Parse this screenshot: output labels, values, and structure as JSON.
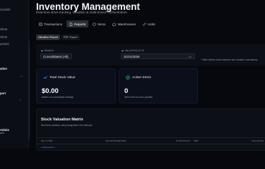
{
  "header": {
    "title": "Inventory Management",
    "subtitle": "Real-time stock tracking, valuation & multi-branch orchestration."
  },
  "sidebar": {
    "items": [
      "ccounts",
      "chers",
      "chers",
      "uchers",
      "ation",
      "port",
      "Admin",
      "ator"
    ]
  },
  "tabs": [
    {
      "label": "Transactions",
      "icon": "list-icon",
      "active": false
    },
    {
      "label": "Reports",
      "icon": "document-icon",
      "active": true
    },
    {
      "label": "Items",
      "icon": "box-icon",
      "active": false
    },
    {
      "label": "Warehouses",
      "icon": "warehouse-icon",
      "active": false
    },
    {
      "label": "Units",
      "icon": "ruler-icon",
      "active": false
    }
  ],
  "report_tabs": [
    {
      "label": "Valuation Report",
      "active": true
    },
    {
      "label": "PDF Export",
      "active": false
    }
  ],
  "filters": {
    "branch_label": "BRANCH",
    "branch_value": "Consolidated (All)",
    "date_label": "VALUATION AS OF",
    "date_value": "31/01/2026",
    "note": "* Table reflects stock balances and valuation calculations."
  },
  "cards": [
    {
      "title": "Total Stock Value",
      "value": "$0.00",
      "sub": "Based on consolidated holdings",
      "icon": "trend-icon",
      "icon_color": "#3b82f6"
    },
    {
      "title": "Active SKUs",
      "value": "0",
      "sub": "Items with non-zero quantity",
      "icon": "check-circle-icon",
      "icon_color": "#22c55e"
    }
  ],
  "matrix": {
    "title": "Stock Valuation Matrix",
    "subtitle": "Real-time valuation using designated cost methods.",
    "columns": [
      "SKU & ITEM",
      "VALUATION METHOD",
      "IN STOCK QTY",
      "UNIT",
      "CALCULATE"
    ],
    "row_preview": "Loading items..."
  }
}
